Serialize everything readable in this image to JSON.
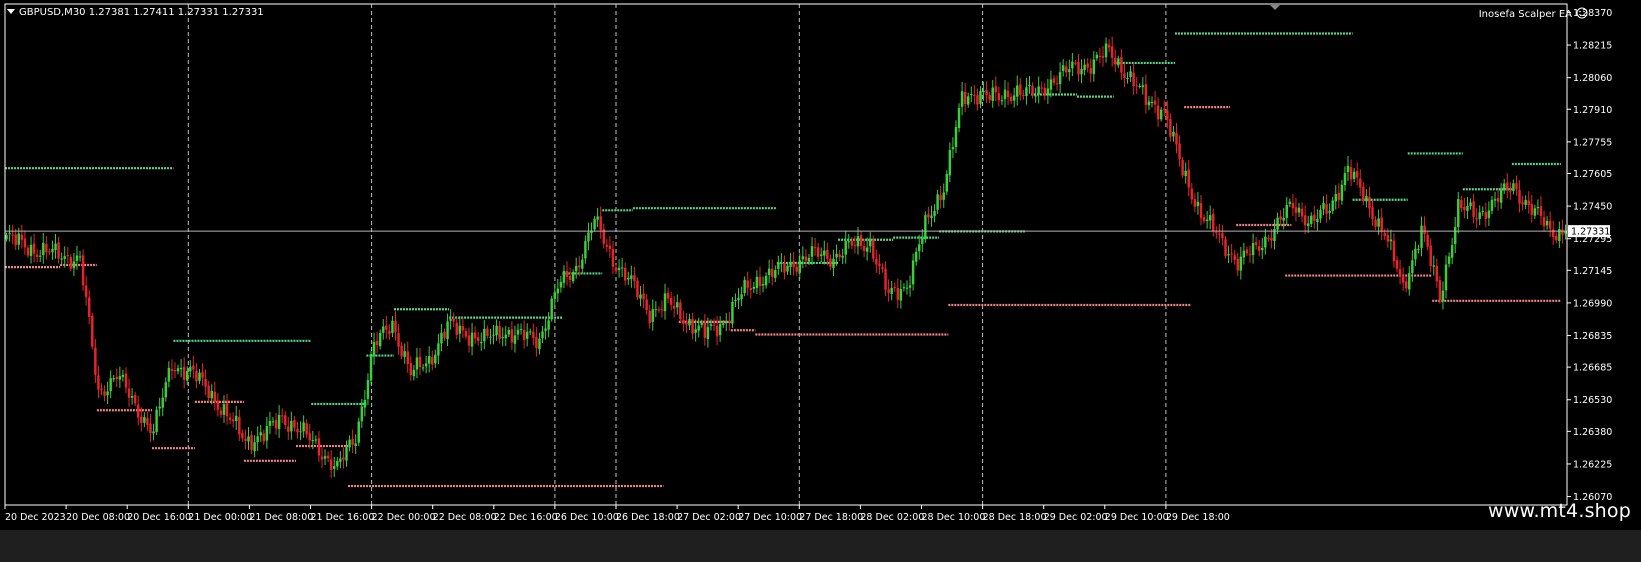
{
  "window": {
    "symbol_title": "GBPUSD,M30  1.27381 1.27411 1.27331 1.27331",
    "ea_label": "Inosefa Scalper EA",
    "ea_status_icon": "smiley-face-icon"
  },
  "footer": {
    "watermark": "www.mt4.shop"
  },
  "colors": {
    "background": "#000000",
    "bull": "#3ccf3c",
    "bear": "#e8242a",
    "resistance": "#5ad48a",
    "support": "#f08585",
    "grid": "#ffffff",
    "price_line": "#b4b4b4"
  },
  "chart_data": {
    "type": "candlestick",
    "symbol": "GBPUSD",
    "timeframe": "M30",
    "ohlc_header": {
      "open": 1.27381,
      "high": 1.27411,
      "low": 1.27331,
      "close": 1.27331
    },
    "current_price_label": "1.27331",
    "ylim": [
      1.2603,
      1.2841
    ],
    "y_ticks": [
      "1.28370",
      "1.28215",
      "1.28060",
      "1.27910",
      "1.27755",
      "1.27605",
      "1.27450",
      "1.27295",
      "1.27145",
      "1.26990",
      "1.26835",
      "1.26685",
      "1.26530",
      "1.26380",
      "1.26225",
      "1.26070"
    ],
    "x_ticks": [
      "20 Dec 2023",
      "20 Dec 08:00",
      "20 Dec 16:00",
      "21 Dec 00:00",
      "21 Dec 08:00",
      "21 Dec 16:00",
      "22 Dec 00:00",
      "22 Dec 08:00",
      "22 Dec 16:00",
      "26 Dec 10:00",
      "26 Dec 18:00",
      "27 Dec 02:00",
      "27 Dec 10:00",
      "27 Dec 18:00",
      "28 Dec 02:00",
      "28 Dec 10:00",
      "28 Dec 18:00",
      "29 Dec 02:00",
      "29 Dec 10:00",
      "29 Dec 18:00"
    ],
    "session_separators": [
      "21 Dec 00:00",
      "22 Dec 00:00",
      "26 Dec 10:00",
      "26 Dec 18:00",
      "27 Dec 18:00",
      "28 Dec 18:00",
      "29 Dec 18:00"
    ],
    "close_path": [
      [
        0,
        1.273
      ],
      [
        8,
        1.2725
      ],
      [
        16,
        1.2722
      ],
      [
        24,
        1.272
      ],
      [
        30,
        1.2656
      ],
      [
        36,
        1.2665
      ],
      [
        42,
        1.265
      ],
      [
        48,
        1.2638
      ],
      [
        54,
        1.267
      ],
      [
        60,
        1.2666
      ],
      [
        66,
        1.2658
      ],
      [
        72,
        1.2645
      ],
      [
        78,
        1.2634
      ],
      [
        84,
        1.2636
      ],
      [
        90,
        1.2645
      ],
      [
        96,
        1.2638
      ],
      [
        102,
        1.263
      ],
      [
        108,
        1.262
      ],
      [
        114,
        1.2636
      ],
      [
        120,
        1.2678
      ],
      [
        126,
        1.269
      ],
      [
        132,
        1.2665
      ],
      [
        138,
        1.2672
      ],
      [
        144,
        1.2688
      ],
      [
        150,
        1.2685
      ],
      [
        156,
        1.2681
      ],
      [
        162,
        1.2686
      ],
      [
        168,
        1.2683
      ],
      [
        174,
        1.2682
      ],
      [
        180,
        1.2706
      ],
      [
        186,
        1.2716
      ],
      [
        192,
        1.2738
      ],
      [
        198,
        1.272
      ],
      [
        204,
        1.2708
      ],
      [
        210,
        1.2695
      ],
      [
        216,
        1.2699
      ],
      [
        222,
        1.2691
      ],
      [
        228,
        1.2684
      ],
      [
        234,
        1.269
      ],
      [
        240,
        1.2703
      ],
      [
        246,
        1.2711
      ],
      [
        252,
        1.2714
      ],
      [
        258,
        1.2719
      ],
      [
        264,
        1.2722
      ],
      [
        270,
        1.2721
      ],
      [
        276,
        1.2726
      ],
      [
        282,
        1.2728
      ],
      [
        288,
        1.2702
      ],
      [
        294,
        1.2708
      ],
      [
        300,
        1.2735
      ],
      [
        306,
        1.2755
      ],
      [
        312,
        1.2795
      ],
      [
        318,
        1.28
      ],
      [
        324,
        1.2795
      ],
      [
        330,
        1.2801
      ],
      [
        336,
        1.2797
      ],
      [
        342,
        1.2806
      ],
      [
        348,
        1.281
      ],
      [
        354,
        1.2813
      ],
      [
        360,
        1.2818
      ],
      [
        366,
        1.2808
      ],
      [
        372,
        1.2795
      ],
      [
        378,
        1.2791
      ],
      [
        384,
        1.2761
      ],
      [
        390,
        1.2742
      ],
      [
        396,
        1.2729
      ],
      [
        402,
        1.2719
      ],
      [
        408,
        1.2724
      ],
      [
        414,
        1.2735
      ],
      [
        420,
        1.2745
      ],
      [
        426,
        1.2738
      ],
      [
        432,
        1.2743
      ],
      [
        438,
        1.2764
      ],
      [
        444,
        1.2746
      ],
      [
        450,
        1.2733
      ],
      [
        456,
        1.2705
      ],
      [
        462,
        1.2735
      ],
      [
        468,
        1.2701
      ],
      [
        474,
        1.2745
      ],
      [
        480,
        1.274
      ],
      [
        486,
        1.2748
      ],
      [
        492,
        1.2754
      ],
      [
        498,
        1.2744
      ],
      [
        504,
        1.2733
      ]
    ],
    "level_lines": [
      {
        "kind": "resistance",
        "start": 0,
        "end": 55,
        "price": 1.2763
      },
      {
        "kind": "support",
        "start": 0,
        "end": 18,
        "price": 1.2716
      },
      {
        "kind": "support",
        "start": 18,
        "end": 30,
        "price": 1.2717
      },
      {
        "kind": "support",
        "start": 30,
        "end": 48,
        "price": 1.2648
      },
      {
        "kind": "support",
        "start": 48,
        "end": 62,
        "price": 1.263
      },
      {
        "kind": "resistance",
        "start": 55,
        "end": 100,
        "price": 1.2681
      },
      {
        "kind": "support",
        "start": 62,
        "end": 78,
        "price": 1.2652
      },
      {
        "kind": "support",
        "start": 78,
        "end": 95,
        "price": 1.2624
      },
      {
        "kind": "support",
        "start": 95,
        "end": 112,
        "price": 1.2631
      },
      {
        "kind": "resistance",
        "start": 100,
        "end": 118,
        "price": 1.2651
      },
      {
        "kind": "support",
        "start": 112,
        "end": 215,
        "price": 1.2612
      },
      {
        "kind": "resistance",
        "start": 118,
        "end": 127,
        "price": 1.2674
      },
      {
        "kind": "resistance",
        "start": 127,
        "end": 145,
        "price": 1.2696
      },
      {
        "kind": "resistance",
        "start": 145,
        "end": 182,
        "price": 1.2692
      },
      {
        "kind": "resistance",
        "start": 182,
        "end": 195,
        "price": 1.2713
      },
      {
        "kind": "resistance",
        "start": 195,
        "end": 205,
        "price": 1.2743
      },
      {
        "kind": "resistance",
        "start": 205,
        "end": 252,
        "price": 1.2744
      },
      {
        "kind": "support",
        "start": 220,
        "end": 237,
        "price": 1.269
      },
      {
        "kind": "support",
        "start": 237,
        "end": 245,
        "price": 1.2686
      },
      {
        "kind": "support",
        "start": 245,
        "end": 308,
        "price": 1.2684
      },
      {
        "kind": "resistance",
        "start": 252,
        "end": 272,
        "price": 1.2718
      },
      {
        "kind": "resistance",
        "start": 272,
        "end": 290,
        "price": 1.2729
      },
      {
        "kind": "resistance",
        "start": 290,
        "end": 305,
        "price": 1.273
      },
      {
        "kind": "resistance",
        "start": 305,
        "end": 333,
        "price": 1.2733
      },
      {
        "kind": "support",
        "start": 308,
        "end": 387,
        "price": 1.2698
      },
      {
        "kind": "resistance",
        "start": 335,
        "end": 350,
        "price": 1.2798
      },
      {
        "kind": "resistance",
        "start": 350,
        "end": 362,
        "price": 1.2797
      },
      {
        "kind": "resistance",
        "start": 362,
        "end": 382,
        "price": 1.2813
      },
      {
        "kind": "resistance",
        "start": 382,
        "end": 440,
        "price": 1.2827
      },
      {
        "kind": "support",
        "start": 385,
        "end": 400,
        "price": 1.2792
      },
      {
        "kind": "support",
        "start": 402,
        "end": 420,
        "price": 1.2736
      },
      {
        "kind": "support",
        "start": 418,
        "end": 466,
        "price": 1.2712
      },
      {
        "kind": "resistance",
        "start": 440,
        "end": 458,
        "price": 1.2748
      },
      {
        "kind": "resistance",
        "start": 458,
        "end": 476,
        "price": 1.277
      },
      {
        "kind": "support",
        "start": 466,
        "end": 508,
        "price": 1.27
      },
      {
        "kind": "resistance",
        "start": 476,
        "end": 492,
        "price": 1.2753
      },
      {
        "kind": "resistance",
        "start": 492,
        "end": 508,
        "price": 1.2765
      }
    ]
  }
}
